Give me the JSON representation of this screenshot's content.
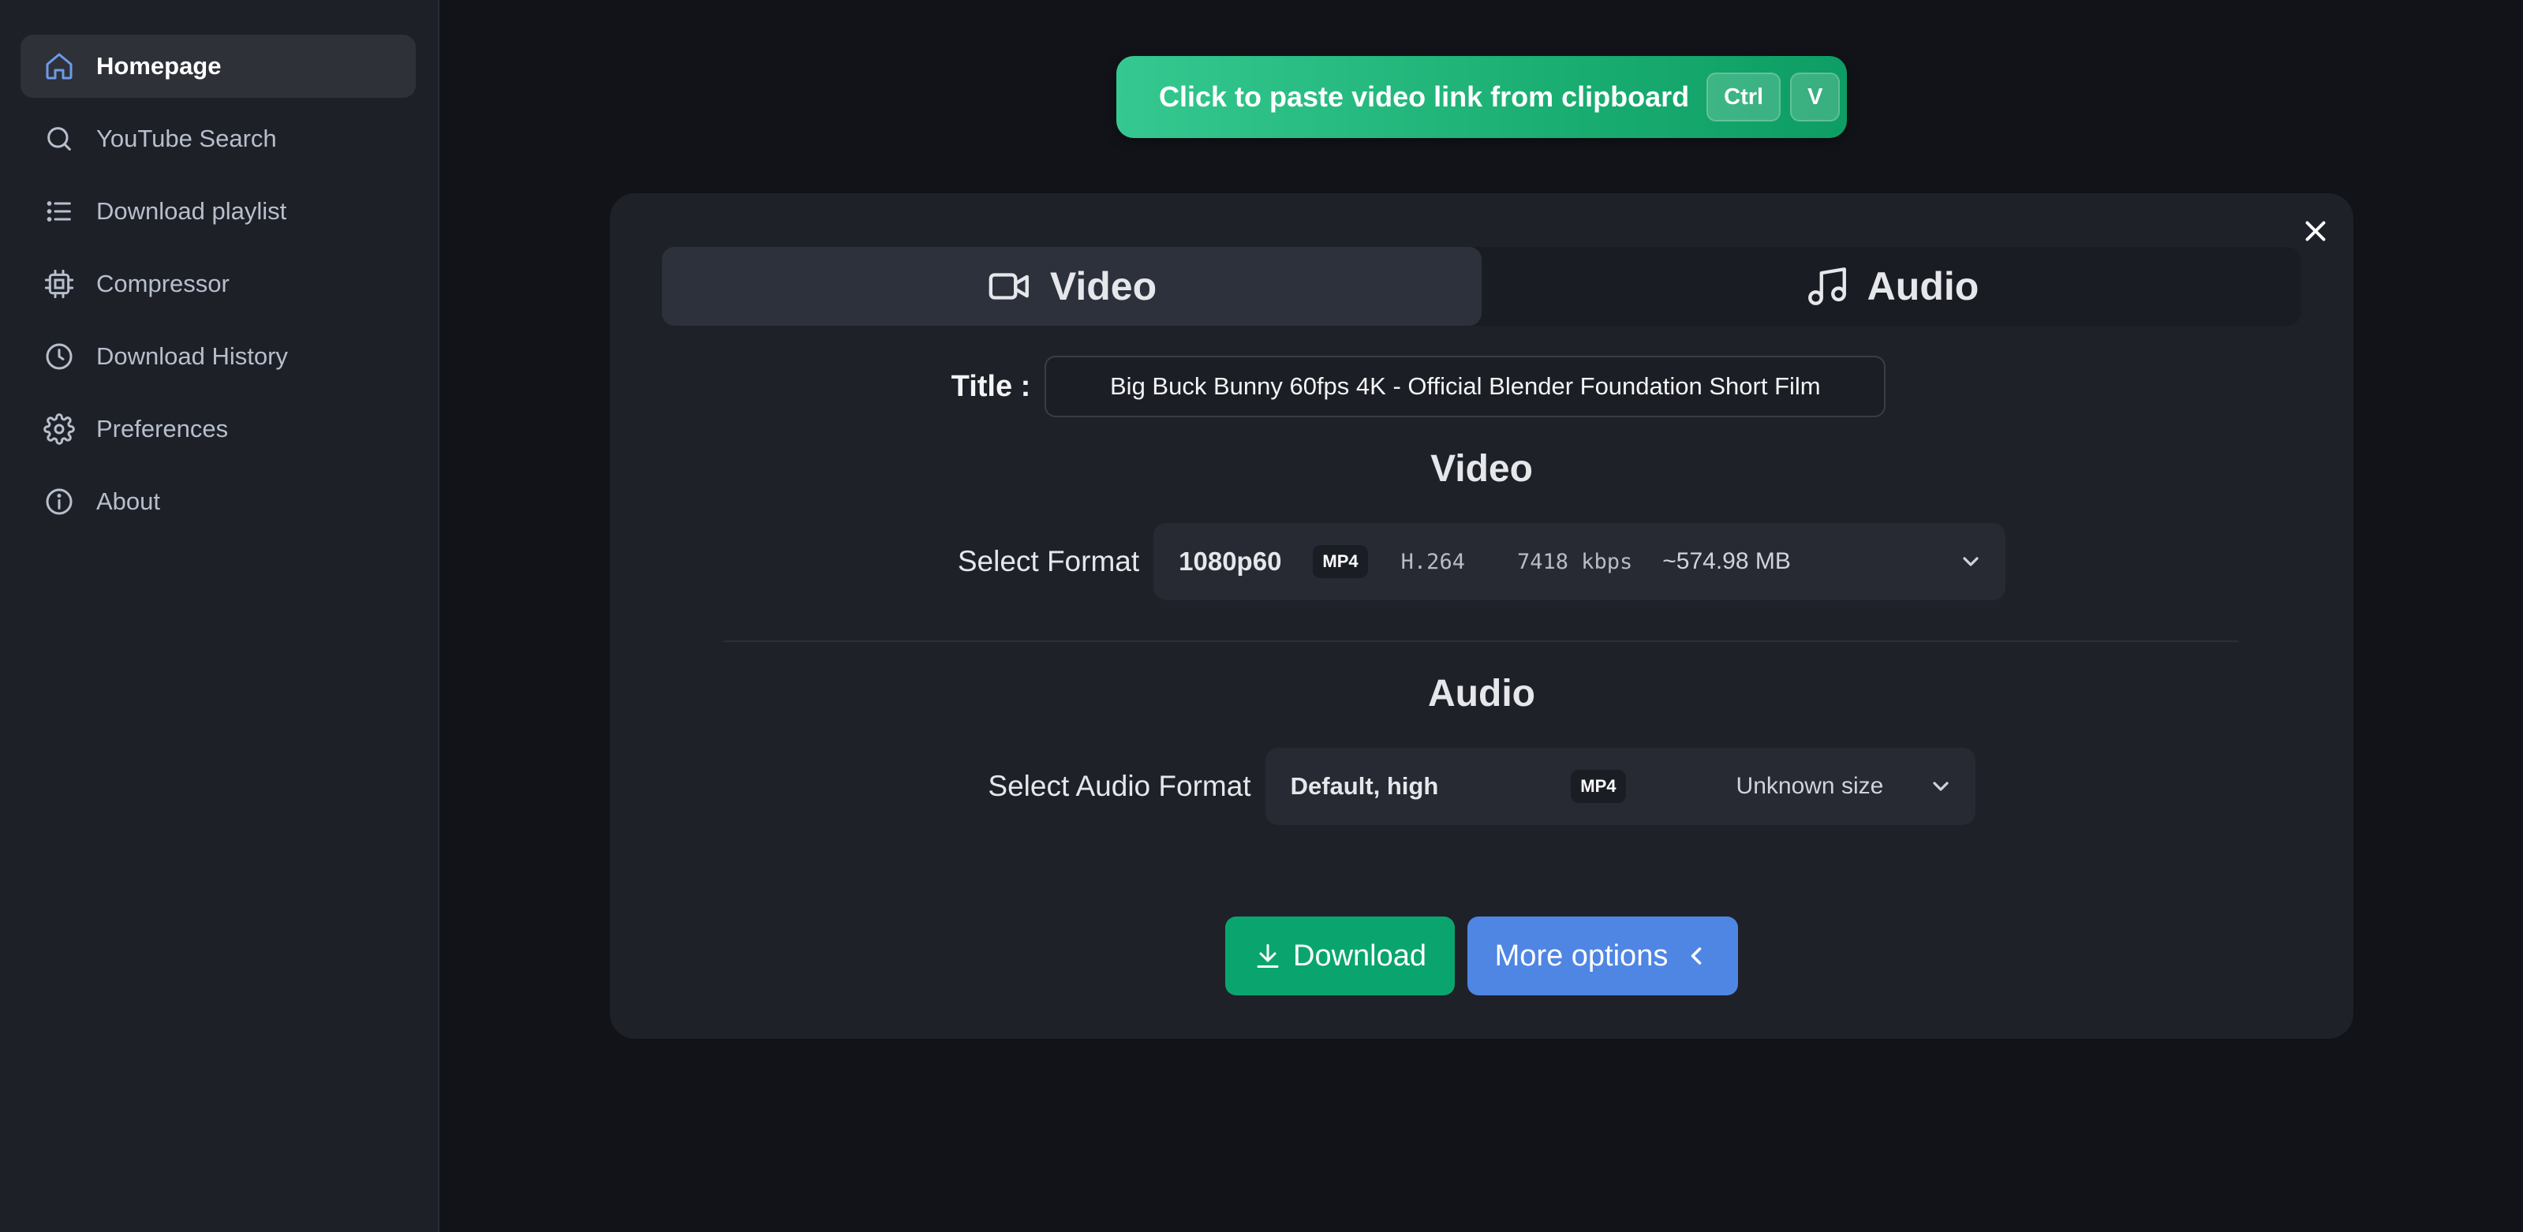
{
  "sidebar": {
    "items": [
      {
        "label": "Homepage",
        "icon": "home-icon",
        "active": true
      },
      {
        "label": "YouTube Search",
        "icon": "search-icon"
      },
      {
        "label": "Download playlist",
        "icon": "list-icon"
      },
      {
        "label": "Compressor",
        "icon": "cpu-icon"
      },
      {
        "label": "Download History",
        "icon": "clock-icon"
      },
      {
        "label": "Preferences",
        "icon": "gear-icon"
      },
      {
        "label": "About",
        "icon": "info-icon"
      }
    ]
  },
  "paste": {
    "label": "Click to paste video link from clipboard",
    "key1": "Ctrl",
    "key2": "V"
  },
  "tabs": {
    "video": "Video",
    "audio": "Audio"
  },
  "title": {
    "label": "Title :",
    "value": "Big Buck Bunny 60fps 4K - Official Blender Foundation Short Film"
  },
  "video_section": {
    "heading": "Video",
    "label": "Select Format",
    "resolution": "1080p60",
    "container": "MP4",
    "codec": "H.264",
    "bitrate": "7418 kbps",
    "size": "~574.98 MB"
  },
  "audio_section": {
    "heading": "Audio",
    "label": "Select Audio Format",
    "quality": "Default, high",
    "container": "MP4",
    "size": "Unknown size"
  },
  "actions": {
    "download": "Download",
    "more": "More options"
  },
  "colors": {
    "accent_green": "#0aa56e",
    "accent_blue": "#4f86e4",
    "active_icon": "#6d9be8"
  }
}
